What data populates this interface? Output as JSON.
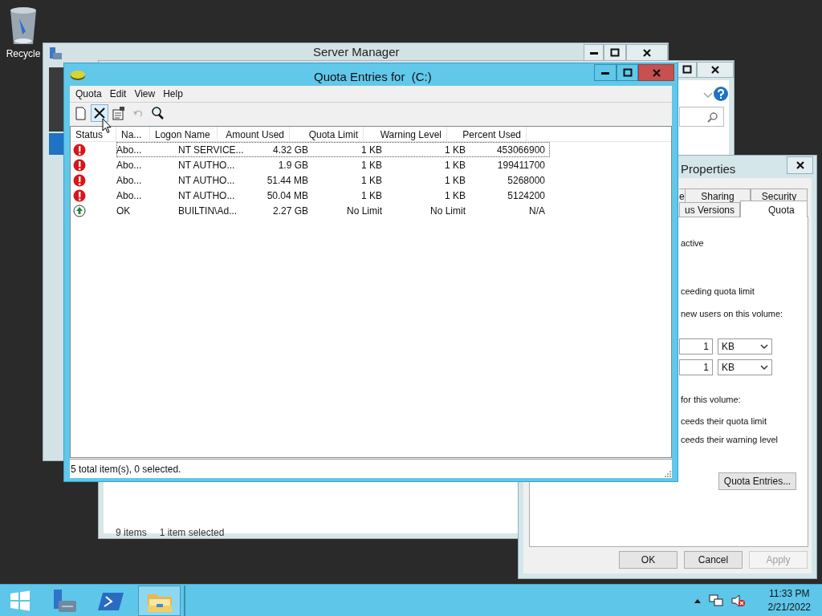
{
  "desktop": {
    "icons": [
      {
        "label": "Recycle"
      }
    ]
  },
  "server_manager": {
    "title": "Server Manager"
  },
  "explorer": {
    "status_bar": [
      "9 items",
      "1 item selected"
    ]
  },
  "properties": {
    "title": "Properties",
    "tabs": [
      {
        "label": "e",
        "selected": false
      },
      {
        "label": "Sharing",
        "selected": false
      },
      {
        "label": "Security",
        "selected": false
      },
      {
        "label": "us Versions",
        "selected": false
      },
      {
        "label": "Quota",
        "selected": true
      }
    ],
    "content": [
      {
        "kind": "text",
        "text": "active"
      },
      {
        "kind": "text",
        "text": "ceeding quota limit"
      },
      {
        "kind": "text",
        "text": "new users on this volume:"
      },
      {
        "kind": "field",
        "value": "1",
        "unit": "KB"
      },
      {
        "kind": "field",
        "value": "1",
        "unit": "KB"
      },
      {
        "kind": "text",
        "text": "for this volume:"
      },
      {
        "kind": "text",
        "text": "ceeds their quota limit"
      },
      {
        "kind": "text",
        "text": "ceeds their warning level"
      }
    ],
    "quota_entries_button": "Quota Entries...",
    "buttons": [
      {
        "label": "OK",
        "disabled": false
      },
      {
        "label": "Cancel",
        "disabled": false
      },
      {
        "label": "Apply",
        "disabled": true
      }
    ]
  },
  "quota_window": {
    "title": "Quota Entries for  (C:)",
    "menu": [
      "Quota",
      "Edit",
      "View",
      "Help"
    ],
    "toolbar": [
      {
        "kind": "new",
        "disabled": false,
        "hovered": false
      },
      {
        "kind": "delete",
        "disabled": false,
        "hovered": true
      },
      {
        "kind": "properties",
        "disabled": false,
        "hovered": false
      },
      {
        "kind": "undo",
        "disabled": true,
        "hovered": false
      },
      {
        "kind": "find",
        "disabled": false,
        "hovered": false
      }
    ],
    "columns": [
      "Status",
      "Na...",
      "Logon Name",
      "Amount Used",
      "Quota Limit",
      "Warning Level",
      "Percent Used"
    ],
    "rows": [
      {
        "kind": "error",
        "status": "Abo...",
        "logon": "NT SERVICE...",
        "amount": "4.32 GB",
        "limit": "1 KB",
        "warning": "1 KB",
        "percent": "453066900",
        "focused": true
      },
      {
        "kind": "error",
        "status": "Abo...",
        "logon": "NT AUTHO...",
        "amount": "1.9 GB",
        "limit": "1 KB",
        "warning": "1 KB",
        "percent": "199411700",
        "focused": false
      },
      {
        "kind": "error",
        "status": "Abo...",
        "logon": "NT AUTHO...",
        "amount": "51.44 MB",
        "limit": "1 KB",
        "warning": "1 KB",
        "percent": "5268000",
        "focused": false
      },
      {
        "kind": "error",
        "status": "Abo...",
        "logon": "NT AUTHO...",
        "amount": "50.04 MB",
        "limit": "1 KB",
        "warning": "1 KB",
        "percent": "5124200",
        "focused": false
      },
      {
        "kind": "ok",
        "status": "OK",
        "logon": "BUILTIN\\Ad...",
        "amount": "2.27 GB",
        "limit": "No Limit",
        "warning": "No Limit",
        "percent": "N/A",
        "focused": false
      }
    ],
    "status_bar": "5 total item(s), 0 selected."
  },
  "taskbar": {
    "items": [
      {
        "kind": "server_manager",
        "active": false
      },
      {
        "kind": "powershell",
        "active": false
      },
      {
        "kind": "explorer",
        "active": true
      }
    ],
    "time": "11:33 PM",
    "date": "2/21/2022"
  }
}
